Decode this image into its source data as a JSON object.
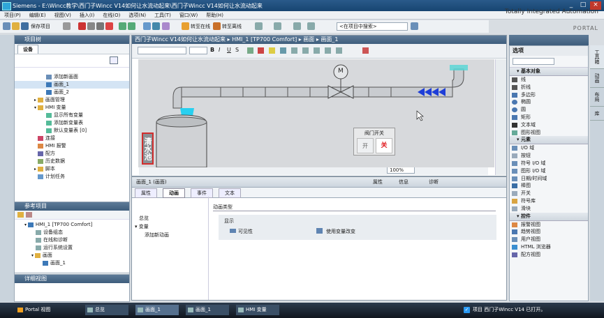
{
  "window": {
    "title": "Siemens  -  E:\\Wincc教学\\西门子Wincc V14如何让水流动起来\\西门子Wincc V14如何让水流动起来"
  },
  "menu": [
    "项目(P)",
    "编辑(E)",
    "视图(V)",
    "插入(I)",
    "在线(O)",
    "选项(N)",
    "工具(T)",
    "窗口(W)",
    "帮助(H)"
  ],
  "brand": "Totally Integrated Automation",
  "brand_sub": "PORTAL",
  "toolbar": {
    "save": "保存项目",
    "online": "转至在线",
    "offline": "转至离线",
    "search": "<在项目中搜索>"
  },
  "project_tree": {
    "header": "项目树",
    "tab": "设备",
    "items": [
      "添加新画面",
      "画面_1",
      "画面_2",
      "画面管理",
      "HMI 变量",
      "显示所有变量",
      "添加新变量表",
      "默认变量表 [0]",
      "连接",
      "HMI 报警",
      "配方",
      "历史数据",
      "脚本",
      "计划任务"
    ]
  },
  "reference": {
    "header": "参考项目",
    "items": [
      "HMI_1 [TP700 Comfort]",
      "设备组态",
      "在线和诊断",
      "运行系统设置",
      "画面",
      "画面_1"
    ]
  },
  "details": {
    "header": "详细视图"
  },
  "editor": {
    "breadcrumb": "西门子Wincc V14如何让水流动起来 ▸ HMI_1 [TP700 Comfort] ▸ 画面 ▸ 画面_1",
    "zoom": "100%",
    "tank_label": "清水池",
    "valve_label": "M",
    "popup_title": "阀门开关",
    "btn_open": "开",
    "btn_close": "关"
  },
  "properties": {
    "title": "画面_1 (画面)",
    "tabs_top": [
      "属性",
      "信息",
      "诊断"
    ],
    "tabs": [
      "属性",
      "动画",
      "事件",
      "文本"
    ],
    "tree": [
      "总览",
      "变量",
      "添加新动画"
    ],
    "section": "动画类型",
    "display": "显示",
    "anim1": "可见性",
    "anim2": "使用变量改变"
  },
  "right": {
    "header": "选项",
    "sections": [
      "基本对象",
      "元素",
      "控件"
    ],
    "basic": [
      "线",
      "折线",
      "多边形",
      "椭圆",
      "圆",
      "矩形",
      "文本域",
      "图形视图"
    ],
    "elements": [
      "I/O 域",
      "按钮",
      "符号 I/O 域",
      "图形 I/O 域",
      "日期/时间域",
      "棒图",
      "开关",
      "符号库",
      "滑块"
    ],
    "controls": [
      "报警视图",
      "趋势视图",
      "用户视图",
      "HTML 浏览器",
      "配方视图"
    ],
    "vtabs": [
      "工具箱",
      "动画",
      "布局",
      "库"
    ]
  },
  "taskbar": {
    "portal": "Portal 视图",
    "items": [
      "总览",
      "画面_1",
      "画面_1",
      "HMI 变量"
    ],
    "status": "项目 西门子Wincc V14 已打开。"
  }
}
